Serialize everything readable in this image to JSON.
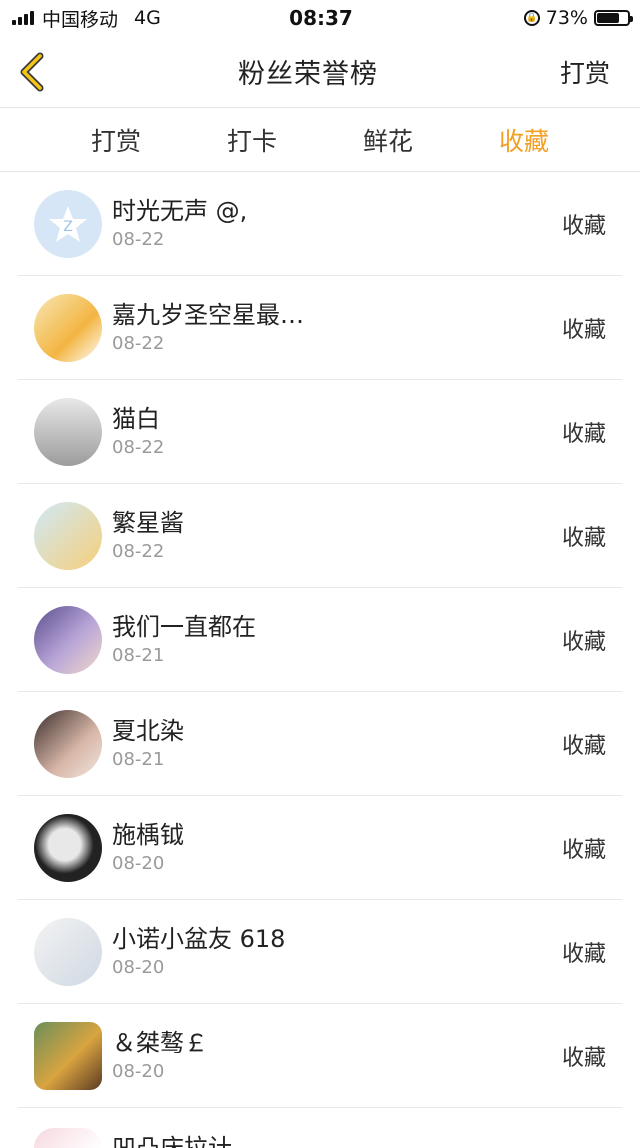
{
  "status_bar": {
    "carrier": "中国移动",
    "network": "4G",
    "time": "08:37",
    "battery_percent": "73%",
    "battery_level": 0.73
  },
  "nav": {
    "title": "粉丝荣誉榜",
    "right_action": "打赏"
  },
  "tabs": [
    {
      "label": "打赏",
      "active": false
    },
    {
      "label": "打卡",
      "active": false
    },
    {
      "label": "鲜花",
      "active": false
    },
    {
      "label": "收藏",
      "active": true
    }
  ],
  "accent_color": "#f2a024",
  "rows": [
    {
      "name": "时光无声 @,",
      "date": "08-22",
      "action": "收藏"
    },
    {
      "name": "嘉九岁圣空星最…",
      "date": "08-22",
      "action": "收藏"
    },
    {
      "name": "猫白",
      "date": "08-22",
      "action": "收藏"
    },
    {
      "name": "繁星酱",
      "date": "08-22",
      "action": "收藏"
    },
    {
      "name": "我们一直都在",
      "date": "08-21",
      "action": "收藏"
    },
    {
      "name": "夏北染",
      "date": "08-21",
      "action": "收藏"
    },
    {
      "name": "施楀钺",
      "date": "08-20",
      "action": "收藏"
    },
    {
      "name": "小诺小盆友 618",
      "date": "08-20",
      "action": "收藏"
    },
    {
      "name": "＆桀骜￡",
      "date": "08-20",
      "action": "收藏"
    }
  ],
  "partial_row": {
    "name": "凹凸床拉计"
  }
}
